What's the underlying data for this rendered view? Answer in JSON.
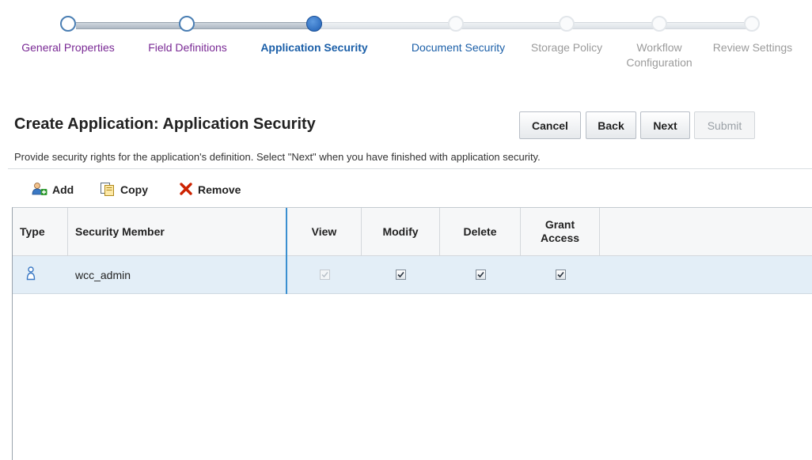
{
  "train": {
    "stops": [
      {
        "label": "General Properties",
        "state": "visited"
      },
      {
        "label": "Field Definitions",
        "state": "visited"
      },
      {
        "label": "Application Security",
        "state": "current"
      },
      {
        "label": "Document Security",
        "state": "next"
      },
      {
        "label": "Storage Policy",
        "state": "disabled"
      },
      {
        "label_line1": "Workflow",
        "label_line2": "Configuration",
        "state": "disabled"
      },
      {
        "label": "Review Settings",
        "state": "disabled"
      }
    ]
  },
  "header": {
    "title": "Create Application: Application Security",
    "instructions": "Provide security rights for the application's definition. Select \"Next\" when you have finished with application security."
  },
  "buttons": {
    "cancel": "Cancel",
    "back": "Back",
    "next": "Next",
    "submit": "Submit"
  },
  "toolbar": {
    "add": "Add",
    "copy": "Copy",
    "remove": "Remove"
  },
  "table": {
    "columns": {
      "type": "Type",
      "member": "Security Member",
      "view": "View",
      "modify": "Modify",
      "delete": "Delete",
      "grant_line1": "Grant",
      "grant_line2": "Access"
    },
    "rows": [
      {
        "type_icon": "user-icon",
        "member": "wcc_admin",
        "view": true,
        "view_disabled": true,
        "modify": true,
        "delete": true,
        "grant_access": true
      }
    ]
  },
  "colors": {
    "visited_link": "#7a2a95",
    "current_step": "#1b5fa8",
    "selected_row": "#e3eef7",
    "remove_icon": "#cc2200"
  }
}
